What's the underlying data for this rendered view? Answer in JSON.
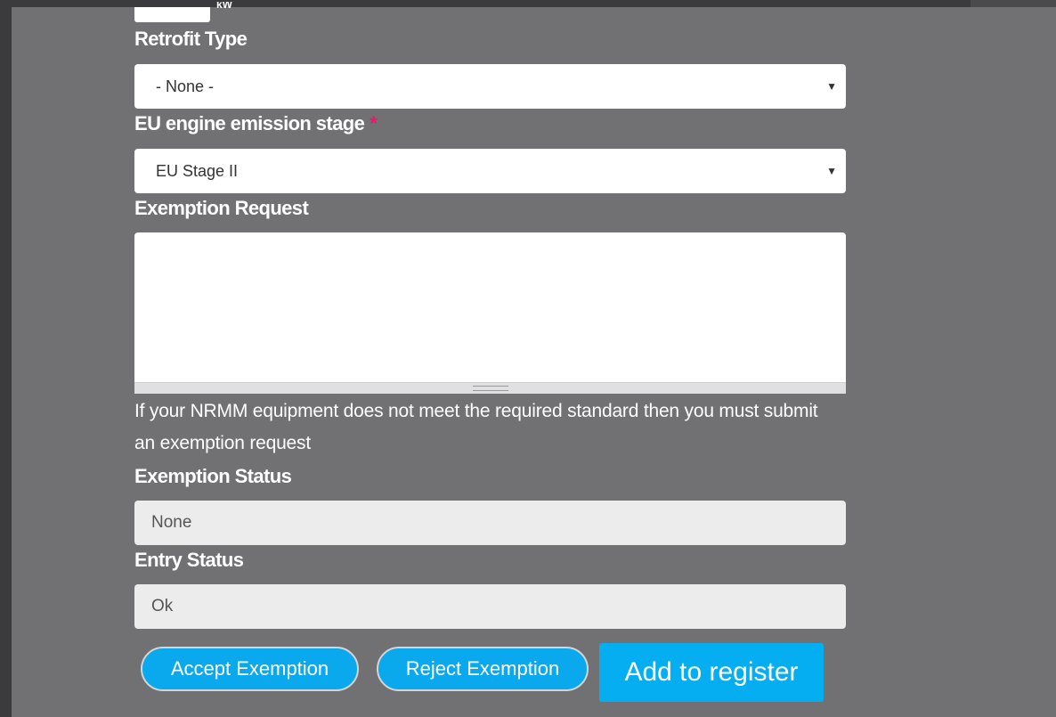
{
  "form": {
    "unit_suffix": "kW",
    "retrofit_type": {
      "label": "Retrofit Type",
      "selected": "- None -"
    },
    "emission_stage": {
      "label": "EU engine emission stage",
      "required_marker": "*",
      "selected": "EU Stage II"
    },
    "exemption_request": {
      "label": "Exemption Request",
      "value": "",
      "help": "If your NRMM equipment does not meet the required standard then you must submit an exemption request"
    },
    "exemption_status": {
      "label": "Exemption Status",
      "value": "None"
    },
    "entry_status": {
      "label": "Entry Status",
      "value": "Ok"
    }
  },
  "actions": {
    "accept_label": "Accept Exemption",
    "reject_label": "Reject Exemption",
    "add_label": "Add to register"
  },
  "colors": {
    "panel": "#717174",
    "button_blue": "#0aa8ec",
    "required_pink": "#e3196c"
  }
}
